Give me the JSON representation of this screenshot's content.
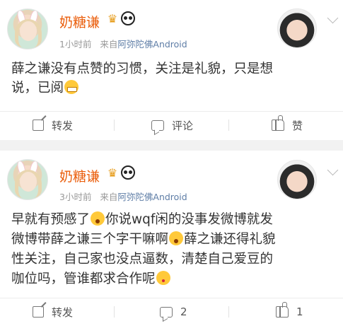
{
  "posts": [
    {
      "username": "奶糖谦",
      "badges": [
        "crown-icon",
        "panda-icon"
      ],
      "time": "1小时前",
      "source_prefix": "来自",
      "source": "阿弥陀佛Android",
      "content": {
        "line1": "薛之谦没有点赞的习惯，关注是礼貌，只是想",
        "line2": "说，已阅"
      },
      "emojis": [
        "grin-emoji"
      ],
      "actions": {
        "share": "转发",
        "comment": "评论",
        "like": "赞"
      }
    },
    {
      "username": "奶糖谦",
      "badges": [
        "crown-icon",
        "panda-icon"
      ],
      "time": "3小时前",
      "source_prefix": "来自",
      "source": "阿弥陀佛Android",
      "content": {
        "line1a": "早就有预感了",
        "line1b": "你说wqf闲的没事发微博就发",
        "line2a": "微博带薛之谦三个字干嘛啊",
        "line2b": "薛之谦还得礼貌",
        "line3": "性关注，自己家也没点逼数，清楚自己爱豆的",
        "line4": "咖位吗，管谁都求合作呢"
      },
      "emojis": [
        "shock-emoji",
        "shock-emoji",
        "kiss-emoji"
      ],
      "actions": {
        "share": "转发",
        "comment": "2",
        "like": "1"
      }
    }
  ],
  "colors": {
    "username": "#ea5d0b",
    "source_link": "#5e7da6",
    "meta": "#999999",
    "background": "#f2f2f2"
  }
}
